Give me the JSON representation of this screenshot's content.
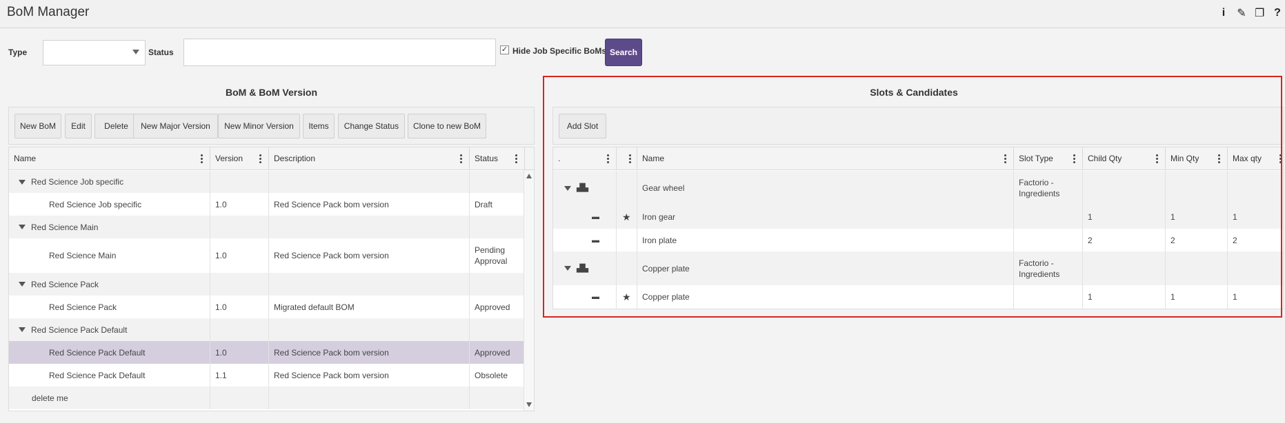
{
  "app": {
    "title": "BoM Manager"
  },
  "toolbar_icons": [
    {
      "name": "info-icon",
      "glyph": "i"
    },
    {
      "name": "pencil-icon",
      "glyph": "✎"
    },
    {
      "name": "window-icon",
      "glyph": "❐"
    },
    {
      "name": "help-icon",
      "glyph": "?"
    }
  ],
  "filters": {
    "type_label": "Type",
    "type_value": "",
    "status_label": "Status",
    "status_value": "",
    "hide_job_specific_label": "Hide Job Specific BoMs",
    "hide_job_specific_checked": true,
    "search_label": "Search"
  },
  "left_panel": {
    "title": "BoM & BoM Version",
    "buttons": [
      "New BoM",
      "Edit",
      "Delete",
      "New Major Version",
      "New Minor Version",
      "Items",
      "Change Status",
      "Clone to new BoM"
    ],
    "columns": [
      "Name",
      "Version",
      "Description",
      "Status"
    ],
    "rows": [
      {
        "name": "Red Science Job specific",
        "version": "",
        "description": "",
        "status": "",
        "group": true
      },
      {
        "name": "Red Science Job specific",
        "version": "1.0",
        "description": "Red Science Pack bom version",
        "status": "Draft",
        "group": false
      },
      {
        "name": "Red Science Main",
        "version": "",
        "description": "",
        "status": "",
        "group": true
      },
      {
        "name": "Red Science Main",
        "version": "1.0",
        "description": "Red Science Pack bom version",
        "status": "Pending Approval",
        "group": false
      },
      {
        "name": "Red Science Pack",
        "version": "",
        "description": "",
        "status": "",
        "group": true
      },
      {
        "name": "Red Science Pack",
        "version": "1.0",
        "description": "Migrated default BOM",
        "status": "Approved",
        "group": false
      },
      {
        "name": "Red Science Pack Default",
        "version": "",
        "description": "",
        "status": "",
        "group": true
      },
      {
        "name": "Red Science Pack Default",
        "version": "1.0",
        "description": "Red Science Pack bom version",
        "status": "Approved",
        "group": false,
        "selected": true
      },
      {
        "name": "Red Science Pack Default",
        "version": "1.1",
        "description": "Red Science Pack bom version",
        "status": "Obsolete",
        "group": false
      },
      {
        "name": "delete me",
        "version": "",
        "description": "",
        "status": "",
        "group": false,
        "plain": true
      }
    ]
  },
  "right_panel": {
    "title": "Slots & Candidates",
    "buttons": [
      "Add Slot"
    ],
    "columns": [
      ".",
      "",
      "Name",
      "Slot Type",
      "Child Qty",
      "Min Qty",
      "Max qty"
    ],
    "rows": [
      {
        "kind": "slot",
        "name": "Gear wheel",
        "slot_type": "Factorio - Ingredients",
        "child_qty": "",
        "min_qty": "",
        "max_qty": ""
      },
      {
        "kind": "candidate",
        "preferred": true,
        "name": "Iron gear",
        "slot_type": "",
        "child_qty": "1",
        "min_qty": "1",
        "max_qty": "1"
      },
      {
        "kind": "candidate",
        "preferred": false,
        "name": "Iron plate",
        "slot_type": "",
        "child_qty": "2",
        "min_qty": "2",
        "max_qty": "2"
      },
      {
        "kind": "slot",
        "name": "Copper plate",
        "slot_type": "Factorio - Ingredients",
        "child_qty": "",
        "min_qty": "",
        "max_qty": ""
      },
      {
        "kind": "candidate",
        "preferred": true,
        "name": "Copper plate",
        "slot_type": "",
        "child_qty": "1",
        "min_qty": "1",
        "max_qty": "1"
      }
    ]
  },
  "colors": {
    "accent": "#5d4a8a",
    "highlight": "#d9231d",
    "selected_row": "#d5cede"
  }
}
